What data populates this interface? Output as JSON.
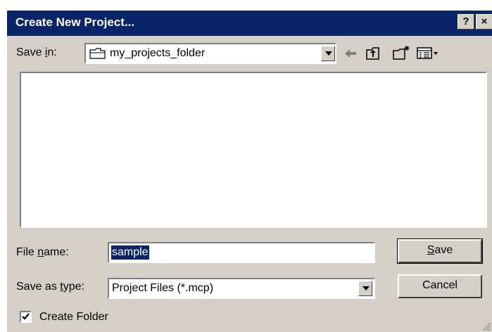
{
  "window": {
    "title": "Create New Project...",
    "help_button": "?",
    "close_button": "×"
  },
  "save_in": {
    "label_pre": "Save ",
    "label_key": "i",
    "label_post": "n:",
    "value": "my_projects_folder",
    "icons": [
      "folder-icon",
      "back-arrow-icon",
      "up-one-level-icon",
      "new-folder-icon",
      "view-menu-icon"
    ]
  },
  "file_list": {
    "items": []
  },
  "file_name": {
    "label_pre": "File ",
    "label_key": "n",
    "label_post": "ame:",
    "value": "sample"
  },
  "save_as_type": {
    "label_pre": "Save as ",
    "label_key": "t",
    "label_post": "ype:",
    "value": "Project Files (*.mcp)"
  },
  "buttons": {
    "save_key": "S",
    "save_rest": "ave",
    "cancel": "Cancel"
  },
  "create_folder": {
    "label": "Create Folder",
    "checked": true
  },
  "colors": {
    "title_bar": "#0a246a",
    "dialog_face": "#d4d0c8",
    "selection": "#0a246a"
  }
}
